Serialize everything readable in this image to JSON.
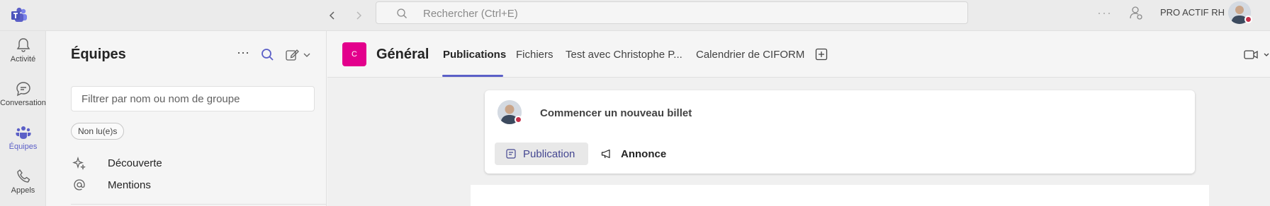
{
  "topbar": {
    "search_placeholder": "Rechercher (Ctrl+E)",
    "more": "···",
    "org_name": "PRO ACTIF RH"
  },
  "rail": {
    "items": [
      {
        "label": "Activité",
        "icon": "bell-icon"
      },
      {
        "label": "Conversation",
        "icon": "chat-icon"
      },
      {
        "label": "Équipes",
        "icon": "teams-icon",
        "active": true
      },
      {
        "label": "Appels",
        "icon": "phone-icon"
      }
    ]
  },
  "panel": {
    "title": "Équipes",
    "more": "···",
    "filter_placeholder": "Filtrer par nom ou nom de groupe",
    "chip": "Non lu(e)s",
    "items": [
      {
        "label": "Découverte",
        "icon": "sparkle-icon"
      },
      {
        "label": "Mentions",
        "icon": "at-icon"
      }
    ]
  },
  "channel": {
    "avatar_letter": "C",
    "name": "Général",
    "tabs": [
      {
        "label": "Publications",
        "active": true
      },
      {
        "label": "Fichiers"
      },
      {
        "label": "Test avec Christophe P..."
      },
      {
        "label": "Calendrier de CIFORM"
      }
    ]
  },
  "composer": {
    "prompt": "Commencer un nouveau billet",
    "post_label": "Publication",
    "announce_label": "Annonce"
  },
  "colors": {
    "accent": "#5b5fc7",
    "channel_avatar": "#e3008c",
    "presence_busy": "#c4314b"
  }
}
